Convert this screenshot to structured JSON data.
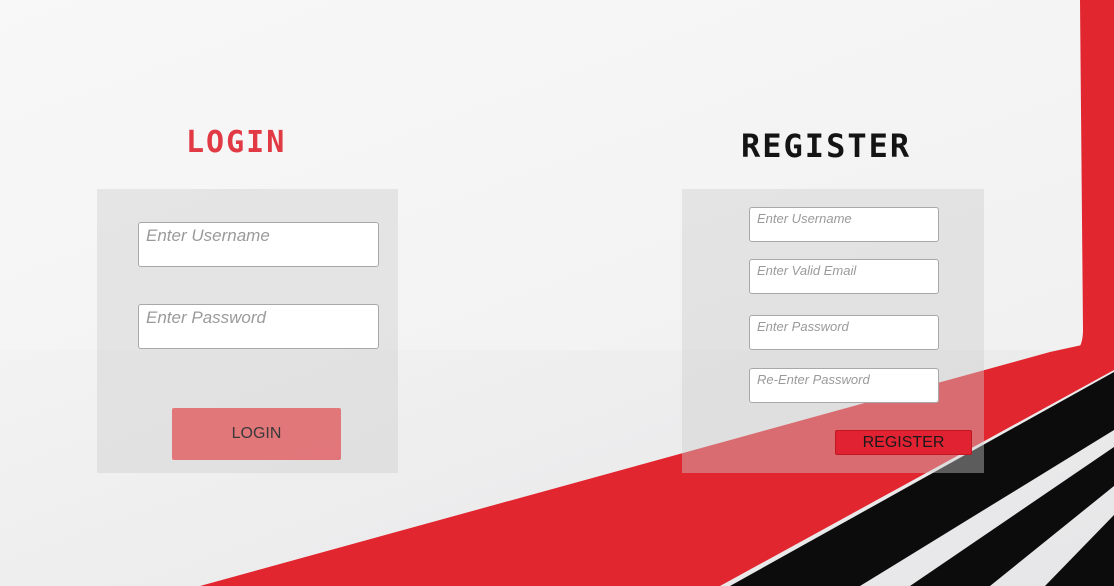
{
  "login": {
    "title": "LOGIN",
    "username_placeholder": "Enter Username",
    "password_placeholder": "Enter Password",
    "button_label": "LOGIN"
  },
  "register": {
    "title": "REGISTER",
    "username_placeholder": "Enter Username",
    "email_placeholder": "Enter Valid Email",
    "password_placeholder": "Enter Password",
    "repassword_placeholder": "Re-Enter Password",
    "button_label": "REGISTER"
  },
  "theme": {
    "accent": "#e12232",
    "login_title_color": "#e23a44",
    "register_title_color": "#141414",
    "stripe_dark": "#0c0c0c"
  }
}
